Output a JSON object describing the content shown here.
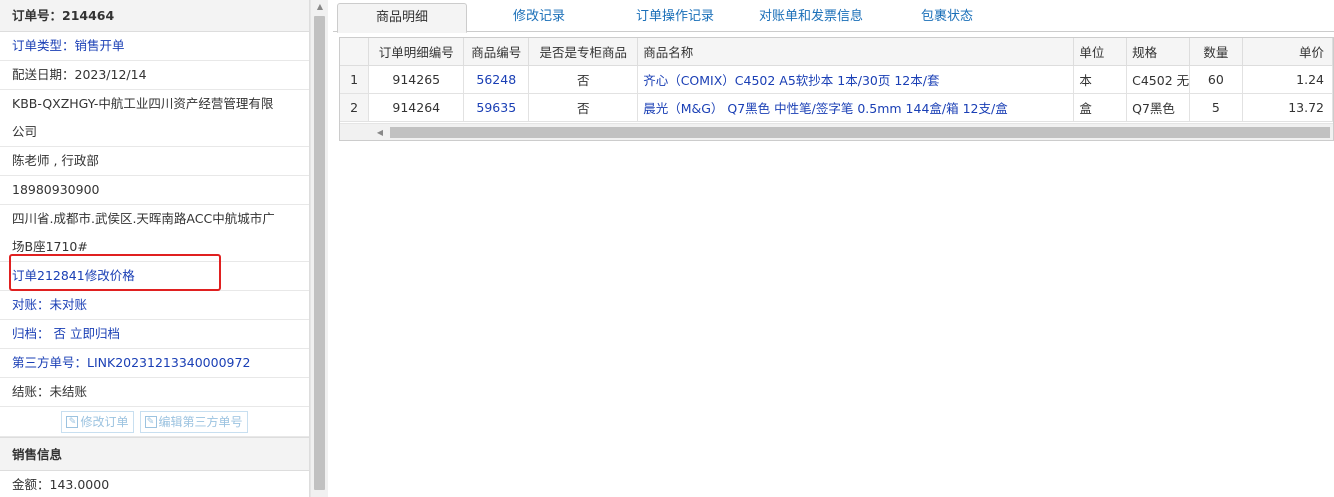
{
  "order": {
    "header": "订单号：214464",
    "type": "订单类型：销售开单",
    "delivery_date": "配送日期：2023/12/14",
    "customer_line1": "KBB-QXZHGY-中航工业四川资产经营管理有限",
    "customer_line2": "公司",
    "contact": "陈老师 , 行政部",
    "phone": "18980930900",
    "address_line1": "四川省.成都市.武侯区.天晖南路ACC中航城市广",
    "address_line2": "场B座1710#",
    "price_change_note": "订单212841修改价格",
    "reconcile": "对账：未对账",
    "archive_label": "归档：",
    "archive_value": "否",
    "archive_link": "立即归档",
    "third_party": "第三方单号：LINK20231213340000972",
    "settle": "结账：未结账",
    "btn_edit_order": "修改订单",
    "btn_edit_third": "编辑第三方单号"
  },
  "sales": {
    "header": "销售信息",
    "amount": "金额：143.0000"
  },
  "tabs": [
    "商品明细",
    "修改记录",
    "订单操作记录",
    "对账单和发票信息",
    "包裹状态"
  ],
  "table": {
    "headers": [
      "",
      "订单明细编号",
      "商品编号",
      "是否是专柜商品",
      "商品名称",
      "单位",
      "规格",
      "数量",
      "单价"
    ],
    "rows": [
      [
        "1",
        "914265",
        "56248",
        "否",
        "齐心（COMIX）C4502 A5软抄本 1本/30页 12本/套",
        "本",
        "C4502 无",
        "60",
        "1.24"
      ],
      [
        "2",
        "914264",
        "59635",
        "否",
        "晨光（M&G） Q7黑色 中性笔/签字笔 0.5mm 144盒/箱 12支/盒",
        "盒",
        "Q7黑色",
        "5",
        "13.72"
      ]
    ]
  },
  "colors": {
    "link": "#1a3fb5",
    "tab": "#1a6fb8",
    "highlight": "#e02020"
  },
  "icons": {
    "edit": "edit-icon",
    "scroll_up": "arrow-up-icon",
    "scroll_left": "arrow-left-icon"
  }
}
